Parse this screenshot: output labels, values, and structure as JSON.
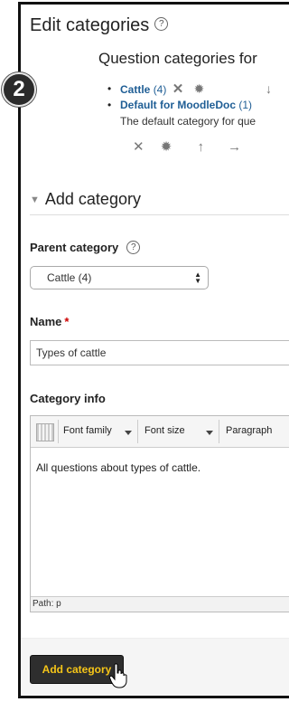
{
  "step_badge": "2",
  "page_title": "Edit categories",
  "help_glyph": "?",
  "list_title": "Question categories for",
  "categories": [
    {
      "name": "Cattle",
      "count": "(4)"
    },
    {
      "name": "Default for MoodleDoc",
      "count": "(1)",
      "description": "The default category for que"
    }
  ],
  "row_actions": [
    "delete-icon",
    "gear-icon",
    "arrow-up-icon",
    "arrow-right-icon"
  ],
  "section": {
    "title": "Add category"
  },
  "form": {
    "parent_label": "Parent category",
    "parent_value": "Cattle (4)",
    "name_label": "Name",
    "required_mark": "*",
    "name_value": "Types of cattle",
    "info_label": "Category info"
  },
  "editor": {
    "font_family": "Font family",
    "font_size": "Font size",
    "format": "Paragraph",
    "content": "All questions about types of cattle.",
    "path": "Path: p"
  },
  "submit_label": "Add category",
  "colors": {
    "link": "#1f5e95",
    "button_bg": "#2e2e2e",
    "button_text": "#f5c518",
    "required": "#cc0000"
  }
}
